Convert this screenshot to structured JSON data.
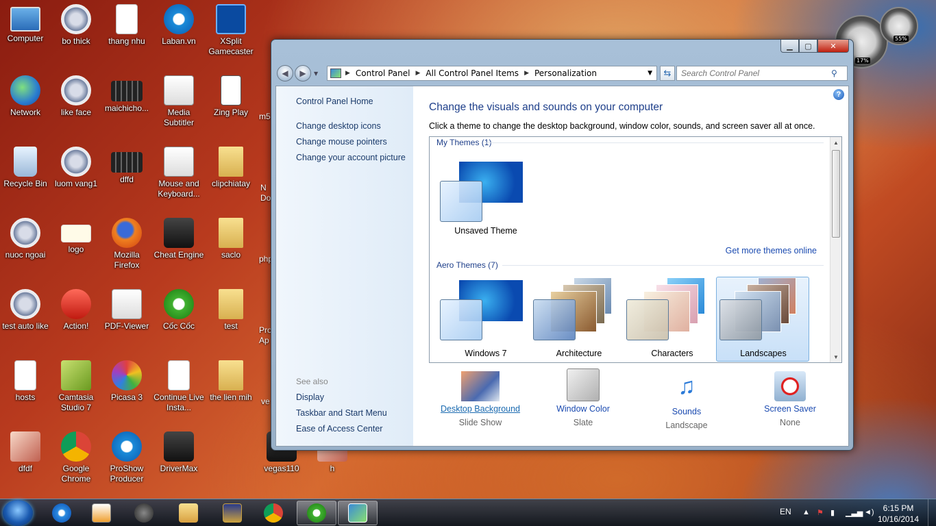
{
  "desktop": {
    "icons": [
      {
        "label": "Computer",
        "icon": "computer-icon"
      },
      {
        "label": "bo thick",
        "icon": "aimp-icon"
      },
      {
        "label": "thang nhu",
        "icon": "mp3-icon"
      },
      {
        "label": "Laban.vn",
        "icon": "laban-icon"
      },
      {
        "label": "XSplit Gamecaster",
        "icon": "xsplit-icon"
      },
      {
        "label": "Network",
        "icon": "network-icon"
      },
      {
        "label": "like face",
        "icon": "aimp-icon"
      },
      {
        "label": "maichicho...",
        "icon": "video-icon"
      },
      {
        "label": "Media Subtitler",
        "icon": "subtitler-icon"
      },
      {
        "label": "Zing Play",
        "icon": "cards-icon"
      },
      {
        "label": "Recycle Bin",
        "icon": "recycle-bin-icon"
      },
      {
        "label": "luom vang1",
        "icon": "aimp-icon"
      },
      {
        "label": "dffd",
        "icon": "video-icon"
      },
      {
        "label": "Mouse and Keyboard...",
        "icon": "mouse-keyboard-icon"
      },
      {
        "label": "clipchiatay",
        "icon": "folder-icon"
      },
      {
        "label": "nuoc ngoai",
        "icon": "aimp-icon"
      },
      {
        "label": "logo",
        "icon": "image-icon"
      },
      {
        "label": "Mozilla Firefox",
        "icon": "firefox-icon"
      },
      {
        "label": "Cheat Engine",
        "icon": "cheat-engine-icon"
      },
      {
        "label": "saclo",
        "icon": "folder-icon"
      },
      {
        "label": "test auto like",
        "icon": "aimp-icon"
      },
      {
        "label": "Action!",
        "icon": "action-icon"
      },
      {
        "label": "PDF-Viewer",
        "icon": "pdf-icon"
      },
      {
        "label": "Cốc Cốc",
        "icon": "coccoc-icon"
      },
      {
        "label": "test",
        "icon": "folder-icon"
      },
      {
        "label": "hosts",
        "icon": "file-icon"
      },
      {
        "label": "Camtasia Studio 7",
        "icon": "camtasia-icon"
      },
      {
        "label": "Picasa 3",
        "icon": "picasa-icon"
      },
      {
        "label": "Continue Live Insta...",
        "icon": "file-icon"
      },
      {
        "label": "the lien mih",
        "icon": "folder-icon"
      },
      {
        "label": "dfdf",
        "icon": "image-icon"
      },
      {
        "label": "Google Chrome",
        "icon": "chrome-icon"
      },
      {
        "label": "ProShow Producer",
        "icon": "proshow-icon"
      },
      {
        "label": "DriverMax",
        "icon": "drivermax-icon"
      },
      {
        "label": "vegas110",
        "icon": "vegas-icon"
      },
      {
        "label": "h",
        "icon": "image-icon"
      }
    ],
    "partial_labels": [
      "m5...",
      "N Do",
      "php",
      "Pro Ap",
      "ve"
    ],
    "gadgets": {
      "cpu": "17%",
      "ram": "55%"
    }
  },
  "window": {
    "controls": {
      "min": "▁",
      "max": "▢",
      "close": "✕"
    },
    "address": {
      "crumbs": [
        "Control Panel",
        "All Control Panel Items",
        "Personalization"
      ]
    },
    "search_placeholder": "Search Control Panel",
    "left": {
      "home": "Control Panel Home",
      "links": [
        "Change desktop icons",
        "Change mouse pointers",
        "Change your account picture"
      ],
      "see_also": "See also",
      "see_also_links": [
        "Display",
        "Taskbar and Start Menu",
        "Ease of Access Center"
      ]
    },
    "main": {
      "title": "Change the visuals and sounds on your computer",
      "description": "Click a theme to change the desktop background, window color, sounds, and screen saver all at once.",
      "my_themes_header": "My Themes (1)",
      "my_themes": [
        {
          "name": "Unsaved Theme"
        }
      ],
      "get_more": "Get more themes online",
      "aero_header": "Aero Themes (7)",
      "aero_themes": [
        {
          "name": "Windows 7"
        },
        {
          "name": "Architecture"
        },
        {
          "name": "Characters"
        },
        {
          "name": "Landscapes",
          "selected": true
        }
      ],
      "bottom": [
        {
          "label": "Desktop Background",
          "value": "Slide Show",
          "icon": "desktop-background-icon"
        },
        {
          "label": "Window Color",
          "value": "Slate",
          "icon": "window-color-icon"
        },
        {
          "label": "Sounds",
          "value": "Landscape",
          "icon": "sounds-icon"
        },
        {
          "label": "Screen Saver",
          "value": "None",
          "icon": "screen-saver-icon"
        }
      ]
    }
  },
  "taskbar": {
    "pinned": [
      "ie-icon",
      "media-player-icon",
      "media-center-icon",
      "explorer-icon",
      "game-icon",
      "chrome-icon",
      "coccoc-icon",
      "control-panel-icon"
    ],
    "lang": "EN",
    "time": "6:15 PM",
    "date": "10/16/2014"
  },
  "colors": {
    "accent": "#1e3f8a",
    "link": "#1a4ab0",
    "selection": "#c8e0f8"
  }
}
